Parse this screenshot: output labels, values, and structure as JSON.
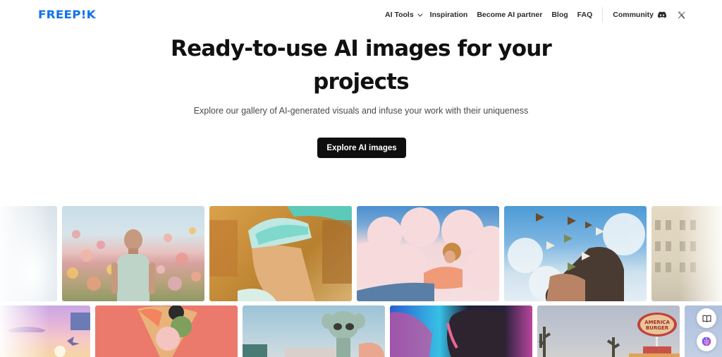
{
  "header": {
    "logo": "FREEP!K",
    "brand_color": "#1273eb",
    "nav": [
      {
        "label": "AI Tools",
        "has_dropdown": true
      },
      {
        "label": "Inspiration"
      },
      {
        "label": "Become AI partner"
      },
      {
        "label": "Blog"
      },
      {
        "label": "FAQ"
      }
    ],
    "community_label": "Community",
    "community_icon": "discord-icon",
    "social_icon": "x-twitter-icon"
  },
  "hero": {
    "title_line1": "Ready-to-use AI images for your",
    "title_line2": "projects",
    "subtitle": "Explore our gallery of AI-generated visuals and infuse your work with their uniqueness",
    "cta_label": "Explore AI images"
  },
  "gallery": {
    "row1": [
      {
        "subject": "clouds"
      },
      {
        "subject": "bald person in flower field"
      },
      {
        "subject": "woman with VR headset in desert canyon"
      },
      {
        "subject": "woman lying on pink clouds"
      },
      {
        "subject": "butterflies emerging from head against sky"
      },
      {
        "subject": "beige building facade"
      }
    ],
    "row2": [
      {
        "subject": "pastel retro sunset with palm trees"
      },
      {
        "subject": "sushi ice cream cone on coral background"
      },
      {
        "subject": "alien figure against sky"
      },
      {
        "subject": "neon-lit faces in profile"
      },
      {
        "subject": "America Burger roadside sign with cacti",
        "sign_text": "AMERICA BURGER"
      },
      {
        "subject": "partial image"
      }
    ]
  },
  "floating_buttons": [
    {
      "icon": "book-icon"
    },
    {
      "icon": "brain-icon"
    }
  ]
}
